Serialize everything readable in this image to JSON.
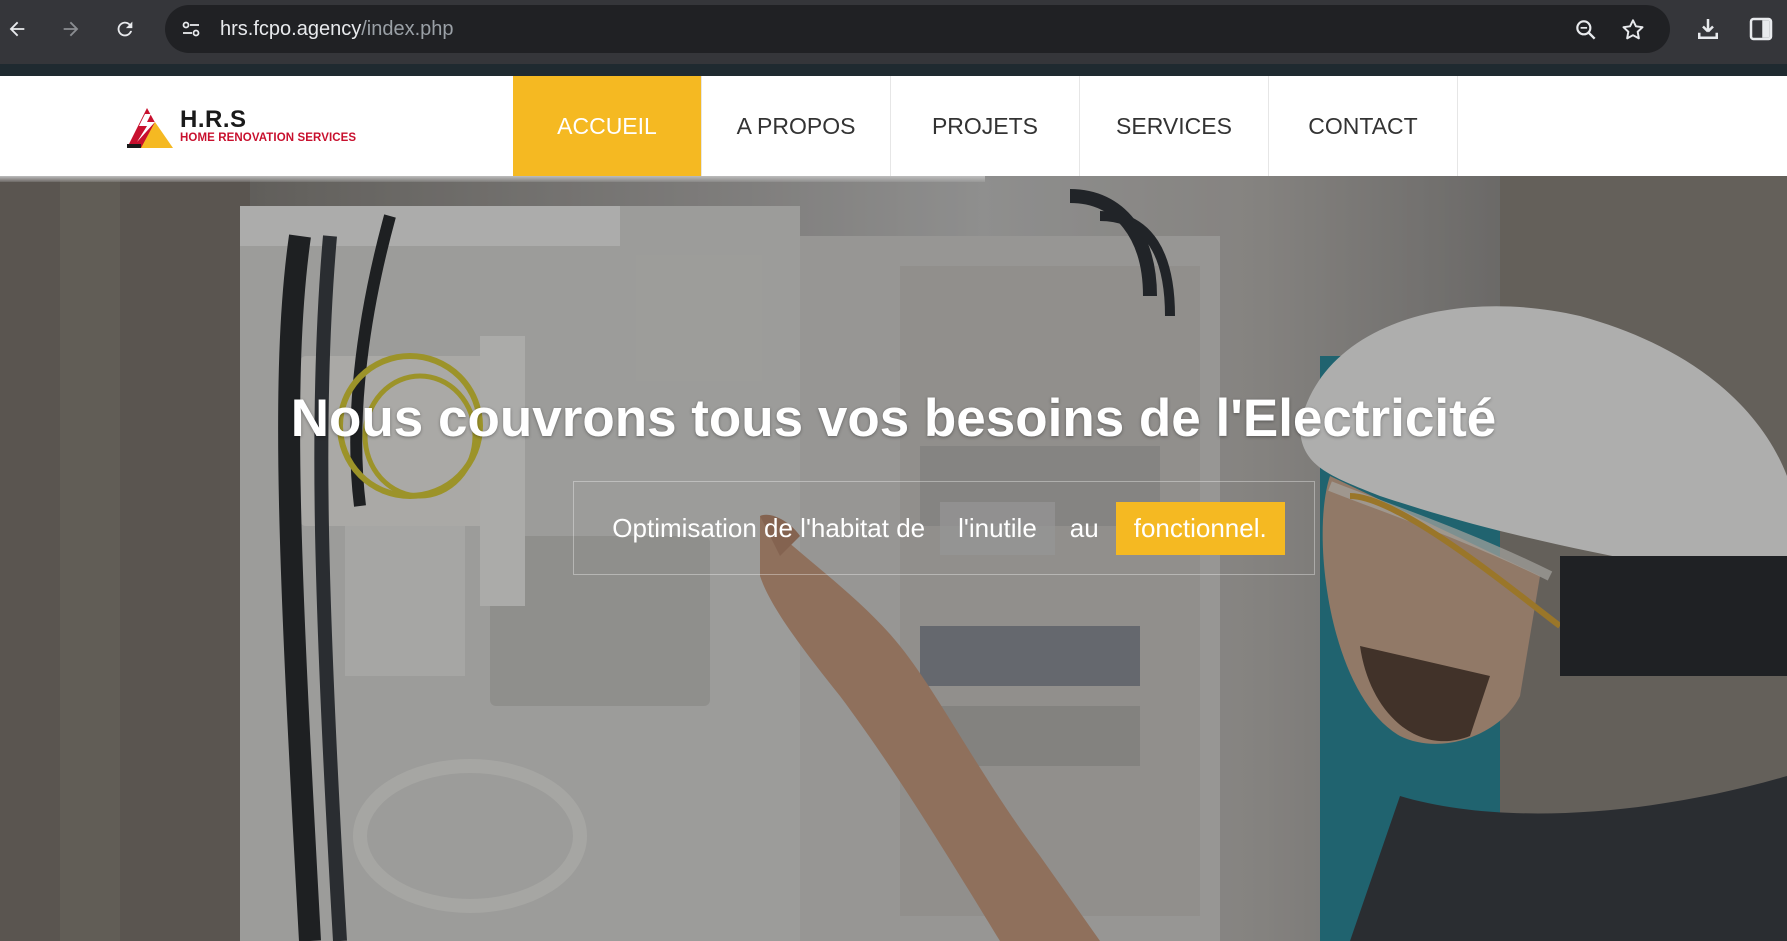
{
  "browser": {
    "url_host": "hrs.fcpo.agency",
    "url_path": "/index.php",
    "icons": [
      "back-arrow-icon",
      "forward-arrow-icon",
      "reload-icon",
      "site-settings-icon",
      "zoom-icon",
      "bookmark-star-icon",
      "download-icon",
      "side-panel-icon"
    ]
  },
  "site": {
    "logo": {
      "brand": "H.R.S",
      "tagline": "HOME RENOVATION SERVICES"
    },
    "nav": [
      {
        "label": "ACCUEIL",
        "active": true
      },
      {
        "label": "A PROPOS",
        "active": false
      },
      {
        "label": "PROJETS",
        "active": false
      },
      {
        "label": "SERVICES",
        "active": false
      },
      {
        "label": "CONTACT",
        "active": false
      }
    ],
    "hero": {
      "title_prefix": "Nous couvrons tous vos besoins de ",
      "title_emphasis": "l'Electricité",
      "tagline_start": "Optimisation de l'habitat de",
      "tagline_chip1": "l'inutile",
      "tagline_mid": "au",
      "tagline_chip2": "fonctionnel."
    }
  },
  "colors": {
    "accent": "#f5b922",
    "logo_red": "#c8102e",
    "chrome_bg": "#35363a",
    "omnibox_bg": "#202124"
  }
}
